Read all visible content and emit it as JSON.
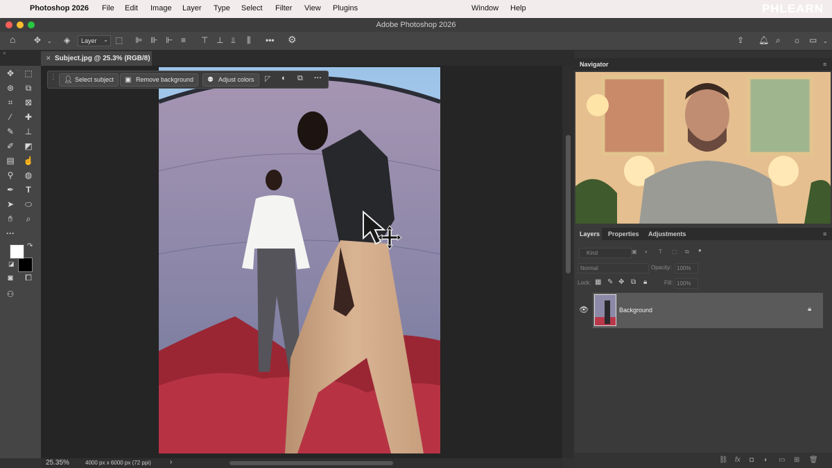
{
  "menubar": {
    "app_name": "Photoshop 2026",
    "items": [
      "File",
      "Edit",
      "Image",
      "Layer",
      "Type",
      "Select",
      "Filter",
      "View",
      "Plugins"
    ],
    "right_items": [
      "Window",
      "Help"
    ],
    "brand": "PHLEARN"
  },
  "window": {
    "title": "Adobe Photoshop 2026"
  },
  "options_bar": {
    "layer_select": "Layer"
  },
  "document_tab": {
    "name": "Subject.jpg @ 25.3% (RGB/8)"
  },
  "context_bar": {
    "select_subject": "Select subject",
    "remove_background": "Remove background",
    "adjust_colors": "Adjust colors"
  },
  "status_bar": {
    "zoom": "25.35%",
    "doc_info": "4000 px x 6000 px (72 ppi)"
  },
  "navigator": {
    "title": "Navigator"
  },
  "layers_panel": {
    "tabs": [
      "Layers",
      "Properties",
      "Adjustments"
    ],
    "filter_placeholder": "Kind",
    "blend_mode": "Normal",
    "opacity_label": "Opacity:",
    "opacity_value": "100%",
    "lock_label": "Lock:",
    "fill_label": "Fill:",
    "fill_value": "100%",
    "layers": [
      {
        "name": "Background"
      }
    ]
  },
  "colors": {
    "accent": "#4a7fd1",
    "traffic_red": "#fe5f57",
    "traffic_yellow": "#febc2e",
    "traffic_green": "#28c840"
  }
}
